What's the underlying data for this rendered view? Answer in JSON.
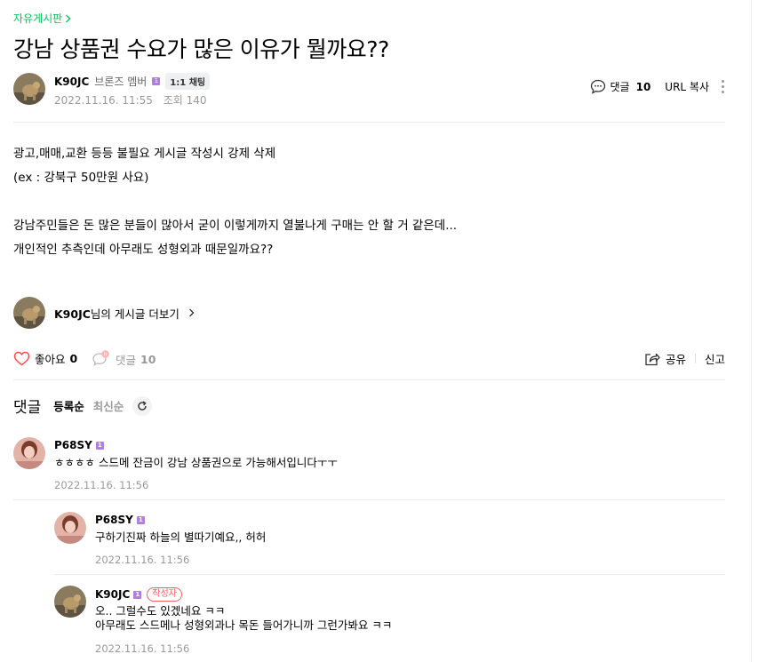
{
  "board": {
    "name": "자유게시판"
  },
  "post": {
    "title": "강남 상품권 수요가 많은 이유가 뭘까요??",
    "author": {
      "nickname": "K90JC",
      "grade": "브론즈 멤버",
      "level_badge": "1",
      "chat_label": "1:1 채팅"
    },
    "date": "2022.11.16. 11:55",
    "views_label": "조회 140",
    "comment_label": "댓글",
    "comment_count": "10",
    "url_copy_label": "URL 복사",
    "body": [
      "광고,매매,교환 등등 불필요 게시글 작성시 강제 삭제",
      "(ex : 강북구 50만원 사요)",
      "",
      "강남주민들은 돈 많은 분들이 많아서 굳이 이렇게까지 열불나게 구매는 안 할 거 같은데...",
      "개인적인 추측인데 아무래도 성형외과 때문일까요??"
    ],
    "more_posts": {
      "nickname": "K90JC",
      "suffix": "님의 게시글 더보기"
    }
  },
  "actions": {
    "like_label": "좋아요",
    "like_count": "0",
    "comment_label": "댓글",
    "comment_count": "10",
    "share_label": "공유",
    "report_label": "신고"
  },
  "comments_section": {
    "title": "댓글",
    "sort_registered": "등록순",
    "sort_latest": "최신순"
  },
  "comments": [
    {
      "nickname": "P68SY",
      "level_badge": "1",
      "text": [
        "ㅎㅎㅎㅎ 스드메 잔금이 강남 상품권으로 가능해서입니다ㅜㅜ"
      ],
      "date": "2022.11.16. 11:56",
      "is_reply": false,
      "writer_badge": ""
    },
    {
      "nickname": "P68SY",
      "level_badge": "1",
      "text": [
        "구하기진짜 하늘의 별따기예요,, 허허"
      ],
      "date": "2022.11.16. 11:56",
      "is_reply": true,
      "writer_badge": ""
    },
    {
      "nickname": "K90JC",
      "level_badge": "1",
      "text": [
        "오.. 그럴수도 있겠네요 ㅋㅋ",
        "아무래도 스드메나 성형외과나 목돈 들어가니까 그런가봐요 ㅋㅋ"
      ],
      "date": "2022.11.16. 11:56",
      "is_reply": true,
      "writer_badge": "작성자"
    }
  ],
  "colors": {
    "accent_green": "#03c75a",
    "like_red": "#ff4b4b",
    "level_purple": "#b07fe0",
    "writer_red": "#ff5e5e"
  }
}
